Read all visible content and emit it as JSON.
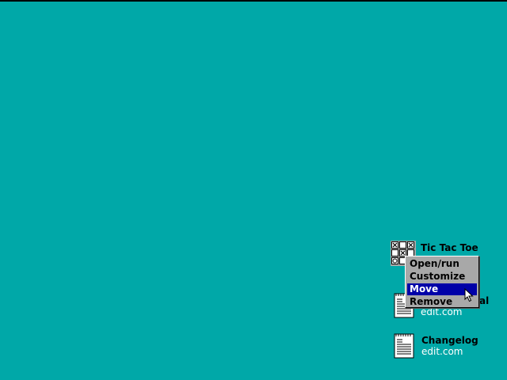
{
  "desktop": {
    "background_color": "#00a8a8",
    "icons": [
      {
        "title": "Tic Tac Toe",
        "subtitle": "",
        "icon": "tic-tac-toe-icon"
      },
      {
        "title": "al",
        "subtitle": "edit.com",
        "icon": "document-icon"
      },
      {
        "title": "Changelog",
        "subtitle": "edit.com",
        "icon": "document-icon"
      }
    ]
  },
  "context_menu": {
    "items": [
      {
        "label": "Open/run"
      },
      {
        "label": "Customize"
      },
      {
        "label": "Move",
        "selected": true
      },
      {
        "label": "Remove"
      }
    ],
    "highlight_color": "#0000a8"
  }
}
